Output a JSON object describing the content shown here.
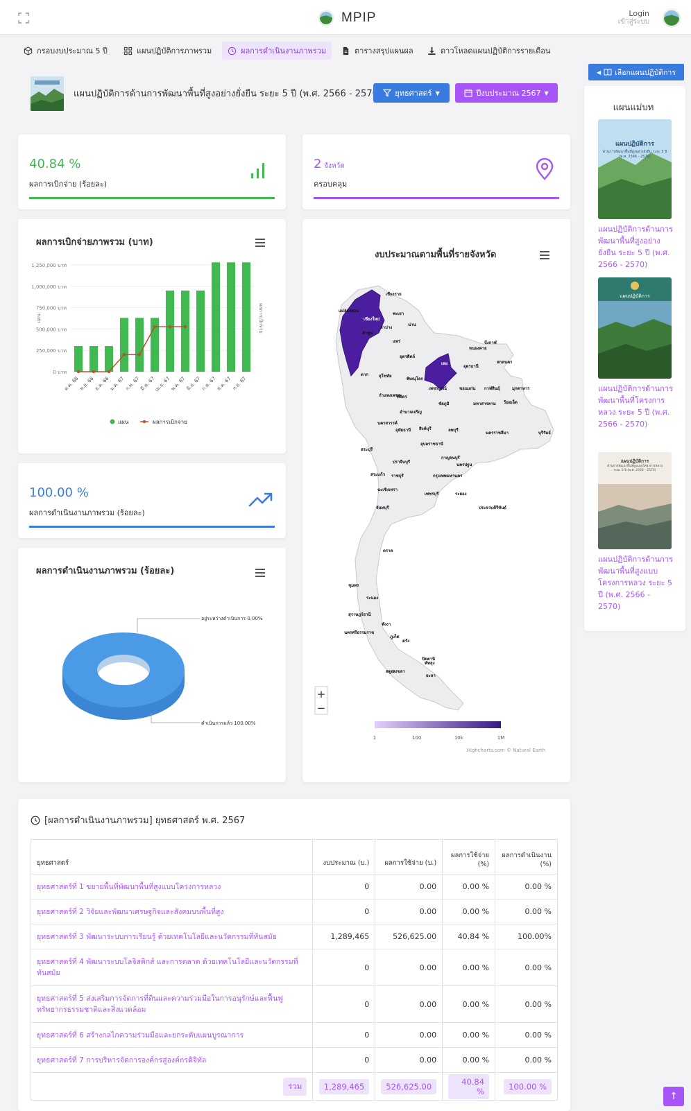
{
  "app": {
    "name": "MPIP",
    "login": "Login",
    "login_sub": "เข้าสู่ระบบ"
  },
  "nav": [
    {
      "label": "กรอบงบประมาณ 5 ปี",
      "icon": "cube-icon"
    },
    {
      "label": "แผนปฏิบัติการภาพรวม",
      "icon": "grid-icon"
    },
    {
      "label": "ผลการดำเนินงานภาพรวม",
      "icon": "history-icon",
      "active": true
    },
    {
      "label": "ตารางสรุปแผนผล",
      "icon": "file-icon"
    },
    {
      "label": "ดาวโหลดแผนปฏิบัติการรายเดือน",
      "icon": "download-icon"
    }
  ],
  "header": {
    "plan_title": "แผนปฏิบัติการด้านการพัฒนาพื้นที่สูงอย่างยั่งยืน ระยะ 5 ปี (พ.ศ. 2566 - 2570)",
    "strategy_btn": "ยุทธศาสตร์",
    "year_btn": "ปีงบประมาณ 2567"
  },
  "kpi": {
    "disburse_value": "40.84 %",
    "disburse_label": "ผลการเบิกจ่าย (ร้อยละ)",
    "province_value": "2",
    "province_unit": "จังหวัด",
    "province_label": "ครอบคลุม",
    "perf_value": "100.00 %",
    "perf_label": "ผลการดำเนินงานภาพรวม (ร้อยละ)"
  },
  "colors": {
    "green": "#3fb950",
    "purple": "#a855f7",
    "blue": "#3a7be0",
    "brown": "#b5532a"
  },
  "chart_data": [
    {
      "type": "bar",
      "title": "ผลการเบิกจ่ายภาพรวม (บาท)",
      "ylabel": "แผน",
      "y2label": "ผลการเบิกจ่าย",
      "categories": [
        "ต.ค. 66",
        "พ.ย. 66",
        "ธ.ค. 66",
        "ม.ค. 67",
        "ก.พ. 67",
        "มี.ค. 67",
        "เม.ย. 67",
        "พ.ค. 67",
        "มิ.ย. 67",
        "ก.ค. 67",
        "ส.ค. 67",
        "ก.ย. 67"
      ],
      "yticks": [
        "0 บาท",
        "250,000 บาท",
        "500,000 บาท",
        "750,000 บาท",
        "1,000,000 บาท",
        "1,250,000 บาท"
      ],
      "ylim": [
        0,
        1250000
      ],
      "series": [
        {
          "name": "แผน",
          "type": "bar",
          "color": "#3fb950",
          "values": [
            300000,
            300000,
            300000,
            630000,
            630000,
            630000,
            950000,
            950000,
            950000,
            1280000,
            1280000,
            1280000
          ]
        },
        {
          "name": "ผลการเบิกจ่าย",
          "type": "line",
          "color": "#b5532a",
          "values": [
            0,
            0,
            0,
            200000,
            200000,
            526625,
            526625,
            526625,
            null,
            null,
            null,
            null
          ]
        }
      ],
      "legend": "bottom"
    },
    {
      "type": "pie",
      "title": "ผลการดำเนินงานภาพรวม (ร้อยละ)",
      "slices": [
        {
          "name": "อยู่ระหว่างดำเนินการ",
          "value": 0.0,
          "label": "อยู่ระหว่างดำเนินการ 0.00%",
          "color": "#a855f7"
        },
        {
          "name": "ดำเนินการแล้ว",
          "value": 100.0,
          "label": "ดำเนินการแล้ว 100.00%",
          "color": "#4a9ae6"
        }
      ]
    }
  ],
  "map": {
    "title": "งบประมาณตามพื้นที่รายจังหวัด",
    "legend_ticks": [
      "1",
      "100",
      "10k",
      "1M"
    ],
    "credit": "Highcharts.com © Natural Earth",
    "highlighted": [
      "เชียงใหม่",
      "เลย"
    ],
    "labels": [
      "เชียงราย",
      "แม่ฮ่องสอน",
      "พะเยา",
      "เชียงใหม่",
      "น่าน",
      "ลำปาง",
      "ลำพูน",
      "แพร่",
      "บึงกาฬ",
      "หนองคาย",
      "สกลนคร",
      "อุดรธานี",
      "อุตรดิตถ์",
      "เลย",
      "ตาก",
      "สุโขทัย",
      "พิษณุโลก",
      "ขอนแก่น",
      "กาฬสินธุ์",
      "มุกดาหาร",
      "กำแพงเพชร",
      "พิจิตร",
      "เพชรบูรณ์",
      "ชัยภูมิ",
      "มหาสารคาม",
      "ร้อยเอ็ด",
      "อำนาจเจริญ",
      "นครสวรรค์",
      "อุทัยธานี",
      "สิงห์บุรี",
      "ลพบุรี",
      "นครราชสีมา",
      "บุรีรัมย์",
      "อุบลราชธานี",
      "สระบุรี",
      "กาญจนบุรี",
      "ปราจีนบุรี",
      "นครปฐม",
      "สระแก้ว",
      "ราชบุรี",
      "กรุงเทพมหานคร",
      "ฉะเชิงเทรา",
      "เพชรบุรี",
      "ระยอง",
      "จันทบุรี",
      "ประจวบคีรีขันธ์",
      "ตราด",
      "ชุมพร",
      "ระนอง",
      "สุราษฎร์ธานี",
      "พังงา",
      "นครศรีธรรมราช",
      "ภูเก็ต",
      "ตรัง",
      "พัทลุง",
      "สงขลา",
      "ปัตตานี",
      "สตูล",
      "ยะลา"
    ]
  },
  "sidebar": {
    "select_btn": "เลือกแผนปฏิบัติการ",
    "title": "แผนแม่บท",
    "books": [
      {
        "cover_title": "แผนปฏิบัติการ",
        "cover_sub": "ด้านการพัฒนาพื้นที่สูงอย่างยั่งยืน ระยะ 5 ปี (พ.ศ. 2566 - 2570)",
        "link": "แผนปฏิบัติการด้านการพัฒนาพื้นที่สูงอย่างยั่งยืน ระยะ 5 ปี (พ.ศ. 2566 - 2570)"
      },
      {
        "cover_title": "แผนปฏิบัติการ",
        "cover_sub": "",
        "link": "แผนปฏิบัติการด้านการพัฒนาพื้นที่โครงการหลวง ระยะ 5 ปี (พ.ศ. 2566 - 2570)"
      },
      {
        "cover_title": "แผนปฏิบัติการ",
        "cover_sub": "ด้านการพัฒนาพื้นที่สูงแบบโครงการหลวง ระยะ 5 ปี (พ.ศ. 2566 - 2570)",
        "link": "แผนปฏิบัติการด้านการพัฒนาพื้นที่สูงแบบโครงการหลวง ระยะ 5 ปี (พ.ศ. 2566 - 2570)"
      }
    ]
  },
  "table": {
    "title": "[ผลการดำเนินงานภาพรวม] ยุทธศาสตร์ พ.ศ. 2567",
    "headers": [
      "ยุทธศาสตร์",
      "งบประมาณ (บ.)",
      "ผลการใช้จ่าย (บ.)",
      "ผลการใช้จ่าย (%)",
      "ผลการดำเนินงาน (%)"
    ],
    "rows": [
      {
        "name": "ยุทธศาสตร์ที่ 1 ขยายพื้นที่พัฒนาพื้นที่สูงแบบโครงการหลวง",
        "budget": "0",
        "spent": "0.00",
        "spent_pct": "0.00 %",
        "perf": "0.00 %"
      },
      {
        "name": "ยุทธศาสตร์ที่ 2 วิจัยและพัฒนาเศรษฐกิจและสังคมบนพื้นที่สูง",
        "budget": "0",
        "spent": "0.00",
        "spent_pct": "0.00 %",
        "perf": "0.00 %"
      },
      {
        "name": "ยุทธศาสตร์ที่ 3 พัฒนาระบบการเรียนรู้ ด้วยเทคโนโลยีและนวัตกรรมที่ทันสมัย",
        "budget": "1,289,465",
        "spent": "526,625.00",
        "spent_pct": "40.84 %",
        "perf": "100.00%"
      },
      {
        "name": "ยุทธศาสตร์ที่ 4 พัฒนาระบบโลจิสติกส์ และการตลาด ด้วยเทคโนโลยีและนวัตกรรมที่ทันสมัย",
        "budget": "0",
        "spent": "0.00",
        "spent_pct": "0.00 %",
        "perf": "0.00 %"
      },
      {
        "name": "ยุทธศาสตร์ที่ 5 ส่งเสริมการจัดการที่ดินและความร่วมมือในการอนุรักษ์และฟื้นฟูทรัพยากรธรรมชาติและสิ่งแวดล้อม",
        "budget": "0",
        "spent": "0.00",
        "spent_pct": "0.00 %",
        "perf": "0.00 %"
      },
      {
        "name": "ยุทธศาสตร์ที่ 6 สร้างกลไกความร่วมมือและยกระดับแผนบูรณาการ",
        "budget": "0",
        "spent": "0.00",
        "spent_pct": "0.00 %",
        "perf": "0.00 %"
      },
      {
        "name": "ยุทธศาสตร์ที่ 7 การบริหารจัดการองค์กรสู่องค์กรดิจิทัล",
        "budget": "0",
        "spent": "0.00",
        "spent_pct": "0.00 %",
        "perf": "0.00 %"
      }
    ],
    "total": {
      "label": "รวม",
      "budget": "1,289,465",
      "spent": "526,625.00",
      "spent_pct": "40.84 %",
      "perf": "100.00 %"
    }
  }
}
